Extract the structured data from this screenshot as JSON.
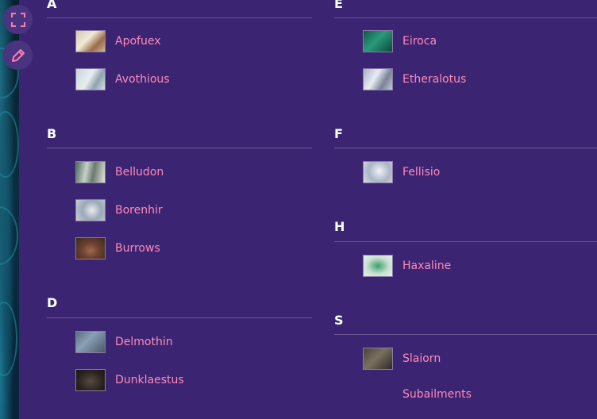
{
  "toolbar": {
    "fullscreen_icon": "fullscreen-icon",
    "edit_icon": "pencil-icon"
  },
  "left_column": [
    {
      "letter": "A",
      "items": [
        {
          "label": "Apofuex"
        },
        {
          "label": "Avothious"
        }
      ]
    },
    {
      "letter": "B",
      "items": [
        {
          "label": "Belludon"
        },
        {
          "label": "Borenhir"
        },
        {
          "label": "Burrows"
        }
      ]
    },
    {
      "letter": "D",
      "items": [
        {
          "label": "Delmothin"
        },
        {
          "label": "Dunklaestus"
        }
      ]
    }
  ],
  "right_column": [
    {
      "letter": "E",
      "items": [
        {
          "label": "Eiroca"
        },
        {
          "label": "Etheralotus"
        }
      ]
    },
    {
      "letter": "F",
      "items": [
        {
          "label": "Fellisio"
        }
      ]
    },
    {
      "letter": "H",
      "items": [
        {
          "label": "Haxaline"
        }
      ]
    },
    {
      "letter": "S",
      "items": [
        {
          "label": "Slaiorn"
        },
        {
          "label": "Subailments"
        }
      ]
    }
  ],
  "colors": {
    "background": "#3b2472",
    "link": "#ff8ab8",
    "heading": "#ffffff",
    "divider": "#6a5590"
  }
}
